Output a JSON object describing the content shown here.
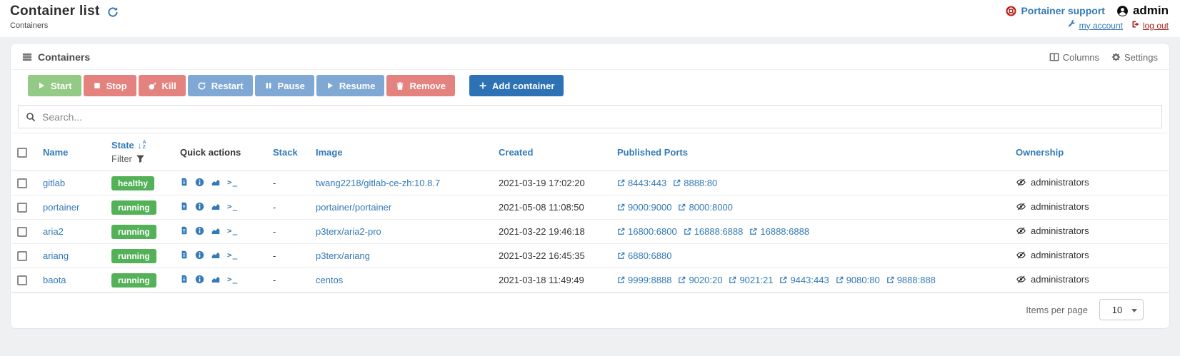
{
  "header": {
    "title": "Container list",
    "breadcrumb": "Containers",
    "support_label": "Portainer support",
    "username": "admin",
    "my_account_label": "my account",
    "log_out_label": "log out"
  },
  "panel": {
    "title": "Containers",
    "columns_label": "Columns",
    "settings_label": "Settings",
    "search_placeholder": "Search...",
    "toolbar_buttons": [
      {
        "id": "start",
        "label": "Start",
        "icon": "play-icon",
        "color": "#93ca85"
      },
      {
        "id": "stop",
        "label": "Stop",
        "icon": "stop-icon",
        "color": "#e3827f"
      },
      {
        "id": "kill",
        "label": "Kill",
        "icon": "bomb-icon",
        "color": "#e3827f"
      },
      {
        "id": "restart",
        "label": "Restart",
        "icon": "restart-icon",
        "color": "#7fa8d4"
      },
      {
        "id": "pause",
        "label": "Pause",
        "icon": "pause-icon",
        "color": "#7fa8d4"
      },
      {
        "id": "resume",
        "label": "Resume",
        "icon": "play-icon",
        "color": "#7fa8d4"
      },
      {
        "id": "remove",
        "label": "Remove",
        "icon": "trash-icon",
        "color": "#e3827f"
      }
    ],
    "add_button": {
      "id": "add-container",
      "label": "Add container",
      "icon": "plus-icon",
      "color": "#2d72b5"
    }
  },
  "table": {
    "headers": {
      "name": "Name",
      "state": "State",
      "filter": "Filter",
      "quick_actions": "Quick actions",
      "stack": "Stack",
      "image": "Image",
      "created": "Created",
      "published_ports": "Published Ports",
      "ownership": "Ownership"
    },
    "quick_action_icons": [
      "logs-icon",
      "inspect-icon",
      "stats-icon",
      "console-icon"
    ],
    "state_colors": {
      "healthy": "#53b157",
      "running": "#53b157"
    },
    "rows": [
      {
        "name": "gitlab",
        "state": "healthy",
        "stack": "-",
        "image": "twang2218/gitlab-ce-zh:10.8.7",
        "created": "2021-03-19 17:02:20",
        "ports": [
          "8443:443",
          "8888:80"
        ],
        "ownership": "administrators"
      },
      {
        "name": "portainer",
        "state": "running",
        "stack": "-",
        "image": "portainer/portainer",
        "created": "2021-05-08 11:08:50",
        "ports": [
          "9000:9000",
          "8000:8000"
        ],
        "ownership": "administrators"
      },
      {
        "name": "aria2",
        "state": "running",
        "stack": "-",
        "image": "p3terx/aria2-pro",
        "created": "2021-03-22 19:46:18",
        "ports": [
          "16800:6800",
          "16888:6888",
          "16888:6888"
        ],
        "ownership": "administrators"
      },
      {
        "name": "ariang",
        "state": "running",
        "stack": "-",
        "image": "p3terx/ariang",
        "created": "2021-03-22 16:45:35",
        "ports": [
          "6880:6880"
        ],
        "ownership": "administrators"
      },
      {
        "name": "baota",
        "state": "running",
        "stack": "-",
        "image": "centos",
        "created": "2021-03-18 11:49:49",
        "ports": [
          "9999:8888",
          "9020:20",
          "9021:21",
          "9443:443",
          "9080:80",
          "9888:888"
        ],
        "ownership": "administrators"
      }
    ]
  },
  "footer": {
    "items_per_page_label": "Items per page",
    "items_per_page_value": "10"
  },
  "colors": {
    "accent": "#337ab7",
    "danger_text": "#a3251f",
    "state_green": "#53b157"
  }
}
